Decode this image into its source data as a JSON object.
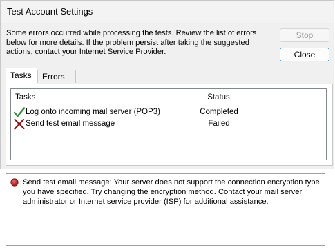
{
  "window": {
    "title": "Test Account Settings"
  },
  "message": "Some errors occurred while processing the tests. Review the list of errors below for more details. If the problem persist after taking the suggested actions, contact your Internet Service Provider.",
  "buttons": {
    "stop": "Stop",
    "close": "Close"
  },
  "tabs": [
    {
      "label": "Tasks",
      "active": true
    },
    {
      "label": "Errors",
      "active": false
    }
  ],
  "table": {
    "columns": [
      "Tasks",
      "Status"
    ],
    "rows": [
      {
        "task": "Log onto incoming mail server (POP3)",
        "status": "Completed",
        "icon": "checkmark-icon"
      },
      {
        "task": "Send test email message",
        "status": "Failed",
        "icon": "x-icon"
      }
    ]
  },
  "error_details": {
    "icon": "error-dot-icon",
    "text": "Send test email message: Your server does not support the connection encryption type you have specified. Try changing the encryption method. Contact your mail server administrator or Internet service provider (ISP) for additional assistance."
  },
  "colors": {
    "check_green": "#2e8b2e",
    "fail_red": "#8b1a1a",
    "accent_blue": "#0067c0"
  }
}
